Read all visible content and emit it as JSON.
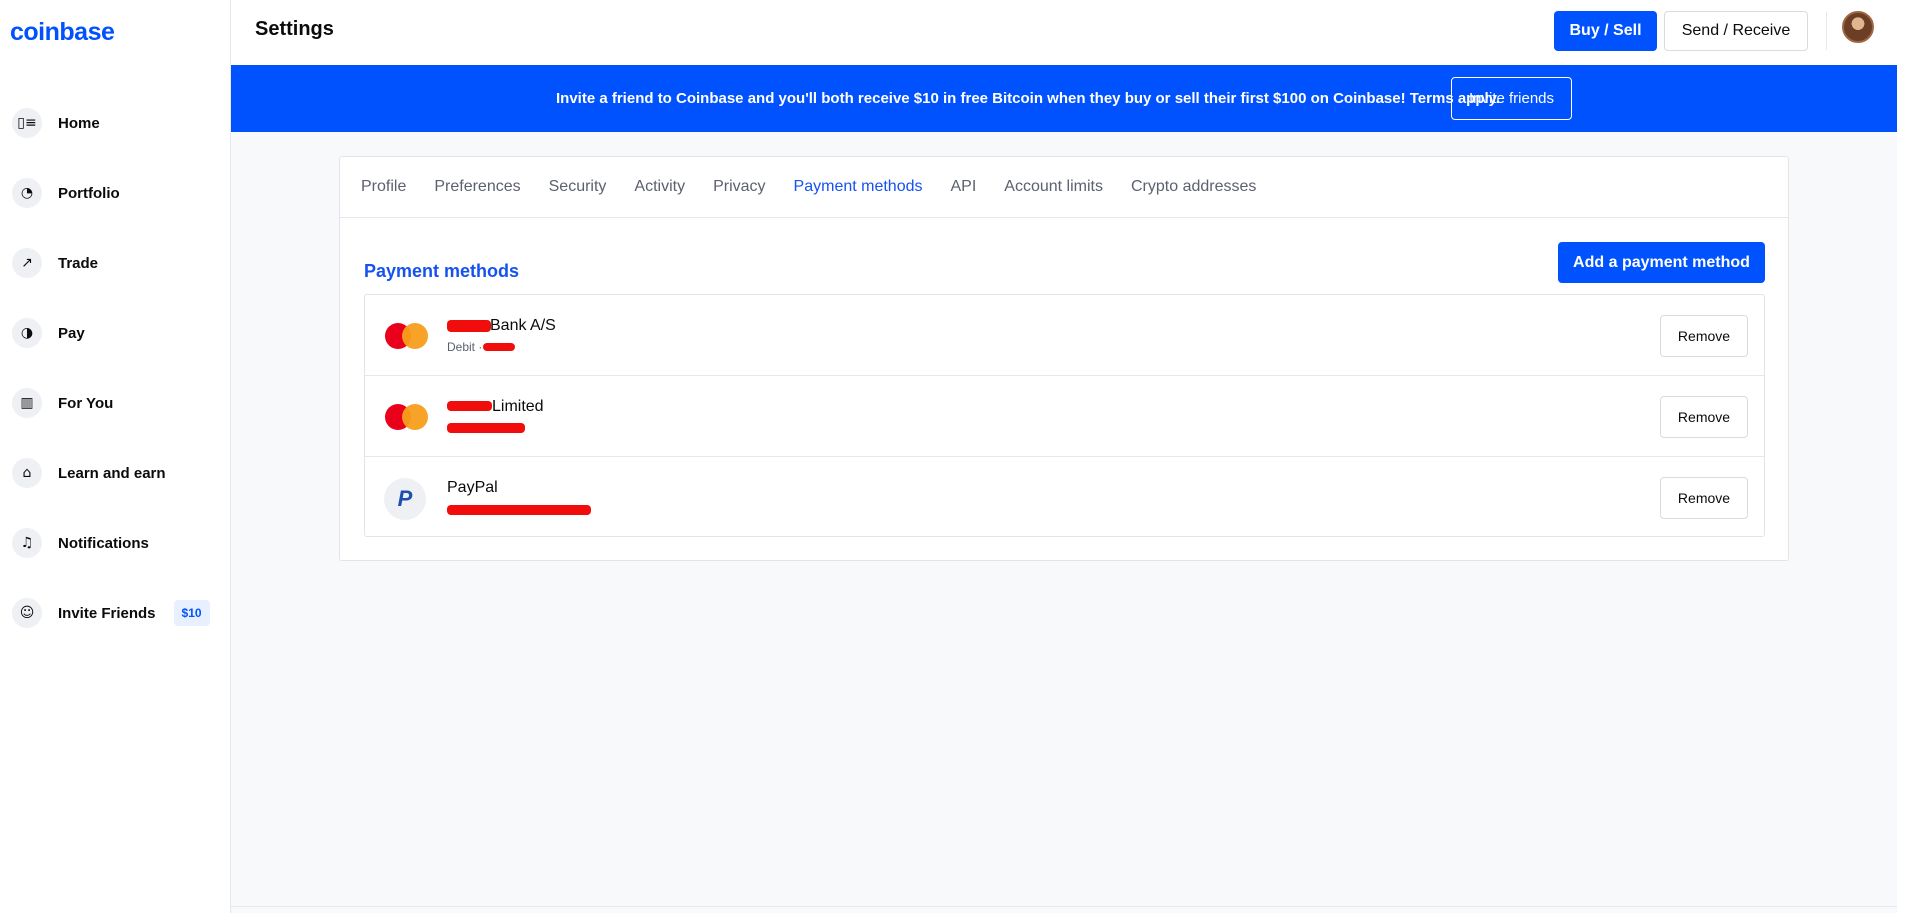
{
  "brand": {
    "logo_text": "coinbase",
    "accent": "#0052ff"
  },
  "sidebar": {
    "items": [
      {
        "label": "Home",
        "icon": "home-icon",
        "glyph": "▯≡"
      },
      {
        "label": "Portfolio",
        "icon": "pie-chart-icon",
        "glyph": "◔"
      },
      {
        "label": "Trade",
        "icon": "trend-icon",
        "glyph": "↗"
      },
      {
        "label": "Pay",
        "icon": "pay-icon",
        "glyph": "◑"
      },
      {
        "label": "For You",
        "icon": "columns-icon",
        "glyph": "▥"
      },
      {
        "label": "Learn and earn",
        "icon": "gift-icon",
        "glyph": "⌂"
      },
      {
        "label": "Notifications",
        "icon": "bell-icon",
        "glyph": "♫"
      },
      {
        "label": "Invite Friends",
        "icon": "add-user-icon",
        "glyph": "☺",
        "badge": "$10"
      }
    ]
  },
  "header": {
    "title": "Settings",
    "buy_sell_label": "Buy / Sell",
    "send_receive_label": "Send / Receive"
  },
  "banner": {
    "text": "Invite a friend to Coinbase and you'll both receive $10 in free Bitcoin when they buy or sell their first $100 on Coinbase! Terms apply.",
    "button_label": "Invite friends"
  },
  "tabs": [
    {
      "label": "Profile",
      "active": false
    },
    {
      "label": "Preferences",
      "active": false
    },
    {
      "label": "Security",
      "active": false
    },
    {
      "label": "Activity",
      "active": false
    },
    {
      "label": "Privacy",
      "active": false
    },
    {
      "label": "Payment methods",
      "active": true
    },
    {
      "label": "API",
      "active": false
    },
    {
      "label": "Account limits",
      "active": false
    },
    {
      "label": "Crypto addresses",
      "active": false
    }
  ],
  "payment_methods": {
    "title": "Payment methods",
    "add_label": "Add a payment method",
    "items": [
      {
        "name": "Bank A/S",
        "sub": "Debit ·",
        "type": "mastercard",
        "remove_label": "Remove"
      },
      {
        "name": "Limited",
        "sub": "",
        "type": "mastercard",
        "remove_label": "Remove"
      },
      {
        "name": "PayPal",
        "sub": "",
        "type": "paypal",
        "remove_label": "Remove"
      }
    ]
  }
}
